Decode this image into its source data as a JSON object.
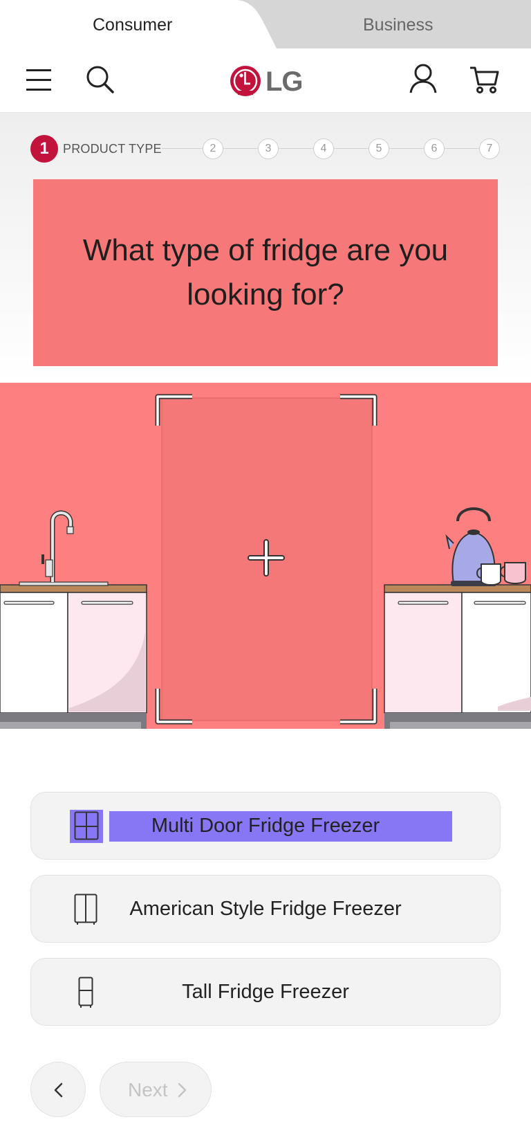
{
  "segment_tabs": {
    "consumer": "Consumer",
    "business": "Business"
  },
  "header": {
    "logo_text": "LG",
    "icons": [
      "menu-icon",
      "search-icon",
      "account-icon",
      "cart-icon"
    ]
  },
  "stepper": {
    "current_step": "1",
    "current_label": "PRODUCT TYPE",
    "steps": [
      "2",
      "3",
      "4",
      "5",
      "6",
      "7"
    ]
  },
  "question": {
    "text": "What type of fridge are you looking for?"
  },
  "options": [
    {
      "label": "Multi Door Fridge Freezer",
      "icon": "multi-door-fridge-icon",
      "selected": true
    },
    {
      "label": "American Style Fridge Freezer",
      "icon": "american-fridge-icon",
      "selected": false
    },
    {
      "label": "Tall Fridge Freezer",
      "icon": "tall-fridge-icon",
      "selected": false
    }
  ],
  "nav": {
    "back_icon": "chevron-left-icon",
    "next_label": "Next",
    "next_icon": "chevron-right-icon"
  },
  "colors": {
    "accent_red": "#c2133d",
    "wall_pink": "#fe7f7f",
    "question_bg": "#f77878",
    "selection_highlight": "#8877f5"
  }
}
